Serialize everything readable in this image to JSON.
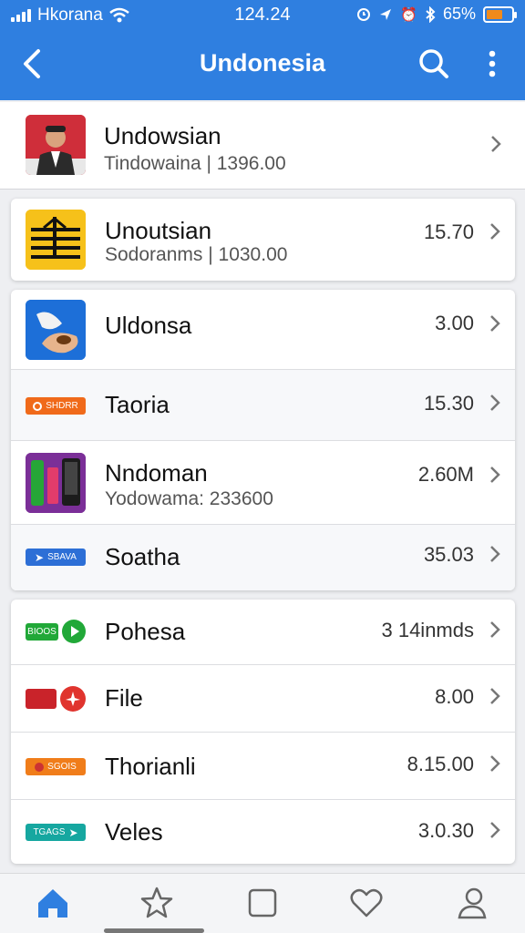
{
  "status_bar": {
    "carrier": "Hkorana",
    "time": "124.24",
    "battery": "65%",
    "battery_level": 0.65,
    "icons": [
      "signal-icon",
      "wifi-icon",
      "alarm-icon",
      "location-icon",
      "bluetooth-icon",
      "battery-icon"
    ]
  },
  "header": {
    "title": "Undonesia",
    "back_icon": "chevron-left-icon",
    "search_icon": "search-icon",
    "more_icon": "more-vertical-icon"
  },
  "cards": [
    {
      "rows": [
        {
          "title": "Undowsian",
          "subtitle": "Tindowaina | 1396.00",
          "value": "",
          "icon": "person-photo"
        }
      ]
    },
    {
      "rows": [
        {
          "title": "Unoutsian",
          "subtitle": "Sodoranms | 1030.00",
          "value": "15.70",
          "icon": "stacked-lines-logo"
        }
      ]
    },
    {
      "rows": [
        {
          "title": "Uldonsa",
          "subtitle": "",
          "value": "3.00",
          "icon": "hand-bird-image"
        },
        {
          "title": "Taoria",
          "subtitle": "",
          "value": "15.30",
          "pill": "SHDRR",
          "pill_color": "#f06a1a"
        },
        {
          "title": "Nndoman",
          "subtitle": "Yodowama: 233600",
          "value": "2.60M",
          "icon": "gadgets-image"
        },
        {
          "title": "Soatha",
          "subtitle": "",
          "value": "35.03",
          "pill": "SBAVA",
          "pill_color": "#2d6fd6"
        }
      ]
    },
    {
      "rows": [
        {
          "title": "Pohesa",
          "subtitle": "",
          "value": "3 14inmds",
          "pill": "BIOOS",
          "pill_color": "#21a838",
          "badge_color": "#21a838"
        },
        {
          "title": "File",
          "subtitle": "",
          "value": "8.00",
          "pill": "",
          "pill_color": "#c9232a",
          "badge_color": "#e0342e"
        },
        {
          "title": "Thorianli",
          "subtitle": "",
          "value": "8.15.00",
          "pill": "SGOIS",
          "pill_color": "#f07d1a"
        },
        {
          "title": "Veles",
          "subtitle": "",
          "value": "3.0.30",
          "pill": "TGAGS",
          "pill_color": "#16a7a0"
        }
      ]
    }
  ],
  "tab_bar": {
    "tabs": [
      {
        "name": "home",
        "icon": "home-icon",
        "active": true
      },
      {
        "name": "favorites",
        "icon": "star-icon",
        "active": false
      },
      {
        "name": "square",
        "icon": "square-icon",
        "active": false
      },
      {
        "name": "likes",
        "icon": "heart-icon",
        "active": false
      },
      {
        "name": "profile",
        "icon": "user-icon",
        "active": false
      }
    ]
  },
  "colors": {
    "header_bg": "#2f7fe0",
    "active_tab": "#2f7fe0",
    "inactive_tab": "#666666"
  }
}
